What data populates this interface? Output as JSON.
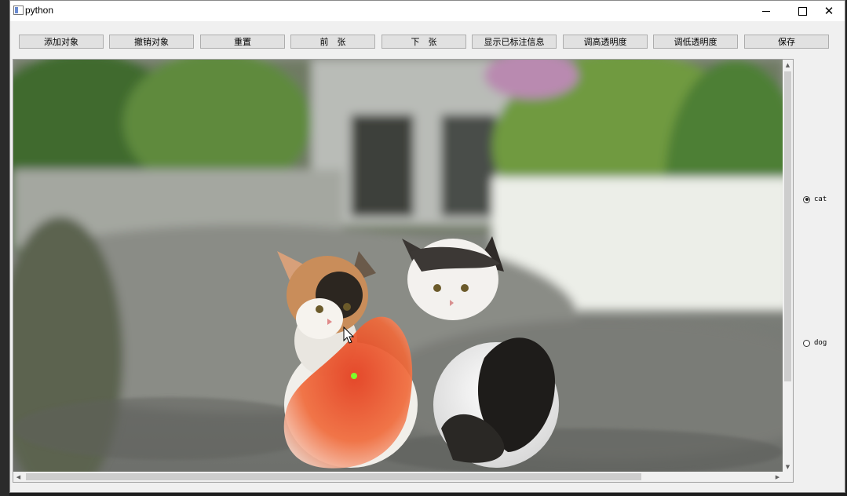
{
  "window": {
    "title": "python"
  },
  "titlebar": {
    "minimize_icon": "minimize-icon",
    "maximize_icon": "maximize-icon",
    "close_icon": "close-icon",
    "close_glyph": "✕"
  },
  "toolbar": {
    "buttons": [
      {
        "label": "添加对象"
      },
      {
        "label": "撤销对象"
      },
      {
        "label": "重置"
      },
      {
        "label": "前　张"
      },
      {
        "label": "下　张"
      },
      {
        "label": "显示已标注信息"
      },
      {
        "label": "调高透明度"
      },
      {
        "label": "调低透明度"
      },
      {
        "label": "保存"
      }
    ]
  },
  "canvas": {
    "image": "photo of two kittens sitting on a gravel path",
    "mask_color": "#e8441e",
    "point_color": "#7dff2a"
  },
  "scrollbars": {
    "up_arrow": "▲",
    "down_arrow": "▼",
    "left_arrow": "◀",
    "right_arrow": "▶"
  },
  "labels": {
    "options": [
      {
        "label": "cat",
        "checked": true
      },
      {
        "label": "dog",
        "checked": false
      }
    ]
  }
}
